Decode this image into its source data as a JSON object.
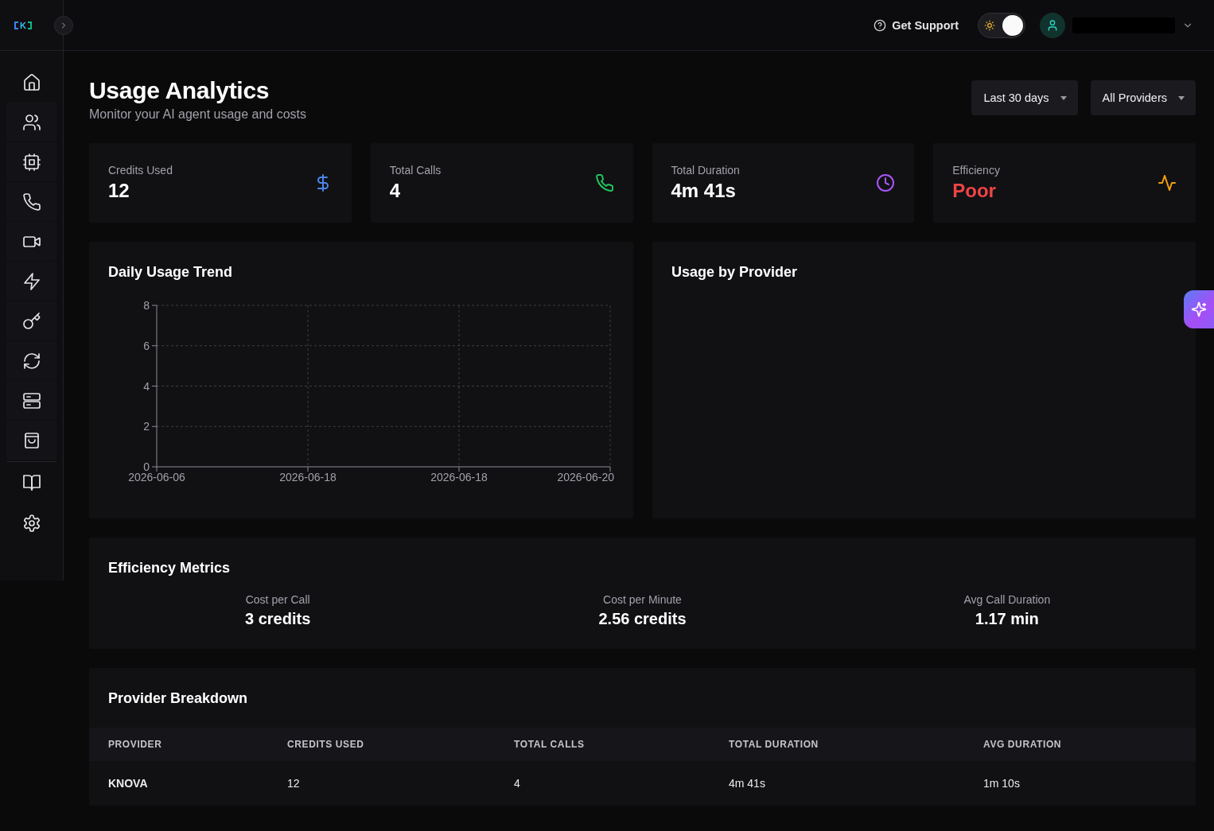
{
  "header": {
    "logo": {
      "text": "K"
    },
    "support_link": {
      "label": "Get Support"
    },
    "theme_toggle": {
      "on": true
    }
  },
  "page": {
    "title": "Usage Analytics",
    "subtitle": "Monitor your AI agent usage and costs",
    "filters": [
      {
        "label": "Last 30 days"
      },
      {
        "label": "All Providers"
      }
    ]
  },
  "stats": [
    {
      "kind": "credits",
      "label": "Credits Used",
      "value": "12",
      "color": "#4a86e8",
      "alert": false
    },
    {
      "kind": "calls",
      "label": "Total Calls",
      "value": "4",
      "color": "#22c55e",
      "alert": false
    },
    {
      "kind": "duration",
      "label": "Total Duration",
      "value": "4m 41s",
      "color": "#a855f7",
      "alert": false
    },
    {
      "kind": "efficiency",
      "label": "Efficiency",
      "value": "Poor",
      "color": "#f59e0b",
      "alert": true
    }
  ],
  "charts": [
    {
      "title": "Daily Usage Trend",
      "chart_data": {
        "type": "line",
        "categories": [
          "2026-06-06",
          "2026-06-18",
          "2026-06-18",
          "2026-06-20"
        ],
        "values": [
          null,
          null,
          null,
          null
        ],
        "ylim": [
          0,
          8
        ],
        "yticks": [
          0,
          2,
          4,
          6,
          8
        ],
        "grid": true
      }
    },
    {
      "title": "Usage by Provider"
    }
  ],
  "efficiency_metrics": {
    "title": "Efficiency Metrics",
    "items": [
      {
        "label": "Cost per Call",
        "value": "3 credits"
      },
      {
        "label": "Cost per Minute",
        "value": "2.56 credits"
      },
      {
        "label": "Avg Call Duration",
        "value": "1.17 min"
      }
    ]
  },
  "provider_breakdown": {
    "title": "Provider Breakdown",
    "columns": [
      "PROVIDER",
      "CREDITS USED",
      "TOTAL CALLS",
      "TOTAL DURATION",
      "AVG DURATION"
    ],
    "rows": [
      [
        "KNOVA",
        "12",
        "4",
        "4m 41s",
        "1m 10s"
      ]
    ]
  }
}
